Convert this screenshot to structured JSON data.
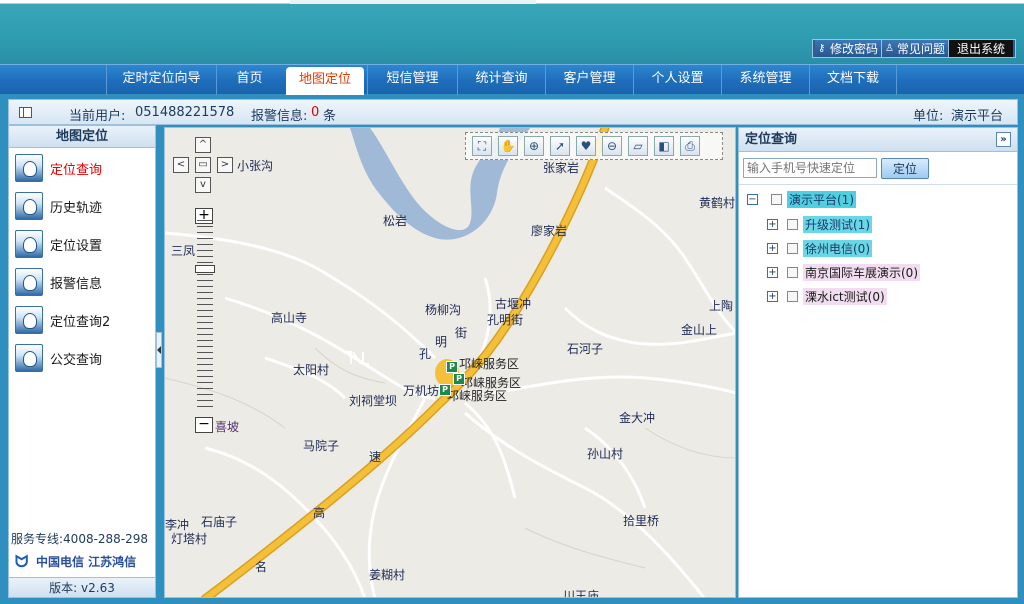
{
  "header": {
    "links": [
      {
        "icon": "key-icon",
        "label": "修改密码"
      },
      {
        "icon": "user-icon",
        "label": "常见问题"
      }
    ],
    "logout_label": "退出系统"
  },
  "nav": {
    "items": [
      "定时定位向导",
      "首页",
      "地图定位",
      "短信管理",
      "统计查询",
      "客户管理",
      "个人设置",
      "系统管理",
      "文档下载"
    ],
    "active_index": 2
  },
  "infobar": {
    "current_user_label": "当前用户:",
    "current_user": "051488221578",
    "alarm_label": "报警信息:",
    "alarm_count": "0",
    "alarm_unit": "条",
    "unit_label": "单位:",
    "unit_name": "演示平台"
  },
  "left": {
    "title": "地图定位",
    "items": [
      "定位查询",
      "历史轨迹",
      "定位设置",
      "报警信息",
      "定位查询2",
      "公交查询"
    ],
    "active_index": 0,
    "hotline": "服务专线:4008-288-298",
    "brand": "中国电信 江苏鸿信",
    "brand_logo_text": "CHINA TELECOM",
    "version": "版本: v2.63"
  },
  "map": {
    "places": [
      {
        "name": "小张沟"
      },
      {
        "name": "张家岩"
      },
      {
        "name": "黄鹤村"
      },
      {
        "name": "松岩"
      },
      {
        "name": "廖家岩"
      },
      {
        "name": "三凤"
      },
      {
        "name": "杨柳沟"
      },
      {
        "name": "古堰冲"
      },
      {
        "name": "孔明街"
      },
      {
        "name": "上陶"
      },
      {
        "name": "高山寺"
      },
      {
        "name": "明"
      },
      {
        "name": "街"
      },
      {
        "name": "金山上"
      },
      {
        "name": "石河子"
      },
      {
        "name": "孔"
      },
      {
        "name": "邛崃服务区"
      },
      {
        "name": "太阳村"
      },
      {
        "name": "邛崃服务区"
      },
      {
        "name": "万机坊"
      },
      {
        "name": "邛崃服务区"
      },
      {
        "name": "刘祠堂坝"
      },
      {
        "name": "金大冲"
      },
      {
        "name": "喜坡"
      },
      {
        "name": "马院子"
      },
      {
        "name": "速"
      },
      {
        "name": "孙山村"
      },
      {
        "name": "李冲"
      },
      {
        "name": "石庙子"
      },
      {
        "name": "高"
      },
      {
        "name": "拾里桥"
      },
      {
        "name": "灯塔村"
      },
      {
        "name": "名"
      },
      {
        "name": "姜糊村"
      },
      {
        "name": "川王庙"
      }
    ],
    "tools": [
      "fullscreen-icon",
      "pan-hand-icon",
      "zoom-in-box-icon",
      "select-arrow-icon",
      "marker-pin-icon",
      "zoom-out-box-icon",
      "measure-ruler-icon",
      "eraser-icon",
      "print-icon"
    ],
    "pan": {
      "up": "^",
      "down": "v",
      "left": "<",
      "right": ">",
      "center": "▭"
    },
    "zoom": {
      "plus": "+",
      "minus": "−",
      "level_fraction": 0.58
    }
  },
  "right": {
    "title": "定位查询",
    "collapse": "»",
    "search_placeholder": "输入手机号快速定位",
    "locate_label": "定位",
    "tree": {
      "root": {
        "label": "演示平台(1)",
        "expander": "−"
      },
      "children": [
        {
          "label": "升级测试(1)",
          "expander": "+",
          "style": "cyan"
        },
        {
          "label": "徐州电信(0)",
          "expander": "+",
          "style": "cyan"
        },
        {
          "label": "南京国际车展演示(0)",
          "expander": "+",
          "style": "pink"
        },
        {
          "label": "溧水ict测试(0)",
          "expander": "+",
          "style": "pink"
        }
      ]
    }
  },
  "colors": {
    "header_teal": "#3aa7b9",
    "nav_blue": "#1f6fbd",
    "active_tab_text": "#e23b00",
    "road_yellow": "#f5c039",
    "river_blue": "#9fb9d6",
    "node_cyan": "#69d7e6",
    "node_pink": "#f2dcef"
  }
}
